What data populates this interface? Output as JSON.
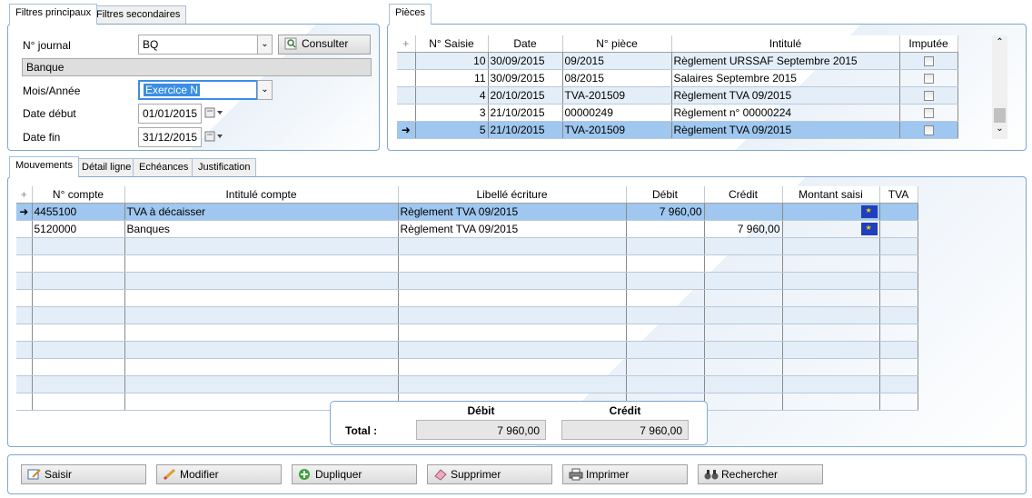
{
  "tabs_top_left": [
    {
      "label": "Filtres principaux"
    },
    {
      "label": "Filtres secondaires"
    }
  ],
  "filters": {
    "journal_label": "N° journal",
    "journal_value": "BQ",
    "consult_label": "Consulter",
    "journal_name": "Banque",
    "period_label": "Mois/Année",
    "period_value": "Exercice N",
    "date_start_label": "Date début",
    "date_start_value": "01/01/2015",
    "date_end_label": "Date fin",
    "date_end_value": "31/12/2015"
  },
  "pieces": {
    "tab_label": "Pièces",
    "columns": [
      "N° Saisie",
      "Date",
      "N° pièce",
      "Intitulé",
      "Imputée"
    ],
    "rows": [
      {
        "saisie": "10",
        "date": "30/09/2015",
        "piece": "09/2015",
        "intitule": "Règlement URSSAF Septembre 2015"
      },
      {
        "saisie": "11",
        "date": "30/09/2015",
        "piece": "08/2015",
        "intitule": "Salaires Septembre 2015"
      },
      {
        "saisie": "4",
        "date": "20/10/2015",
        "piece": "TVA-201509",
        "intitule": "Règlement TVA 09/2015"
      },
      {
        "saisie": "3",
        "date": "21/10/2015",
        "piece": "00000249",
        "intitule": "Règlement n° 00000224"
      },
      {
        "saisie": "5",
        "date": "21/10/2015",
        "piece": "TVA-201509",
        "intitule": "Règlement TVA 09/2015"
      }
    ]
  },
  "tabs_bottom": [
    {
      "label": "Mouvements"
    },
    {
      "label": "Détail ligne"
    },
    {
      "label": "Echéances"
    },
    {
      "label": "Justification"
    }
  ],
  "mouvements": {
    "columns": [
      "N° compte",
      "Intitulé compte",
      "Libellé écriture",
      "Débit",
      "Crédit",
      "Montant saisi",
      "TVA"
    ],
    "rows": [
      {
        "compte": "4455100",
        "intitule": "TVA à décaisser",
        "libelle": "Règlement TVA 09/2015",
        "debit": "7 960,00",
        "credit": ""
      },
      {
        "compte": "5120000",
        "intitule": "Banques",
        "libelle": "Règlement TVA 09/2015",
        "debit": "",
        "credit": "7 960,00"
      }
    ]
  },
  "totals": {
    "debit_header": "Débit",
    "credit_header": "Crédit",
    "total_label": "Total :",
    "debit_value": "7 960,00",
    "credit_value": "7 960,00"
  },
  "actions": {
    "saisir": "Saisir",
    "modifier": "Modifier",
    "dupliquer": "Dupliquer",
    "supprimer": "Supprimer",
    "imprimer": "Imprimer",
    "rechercher": "Rechercher"
  }
}
